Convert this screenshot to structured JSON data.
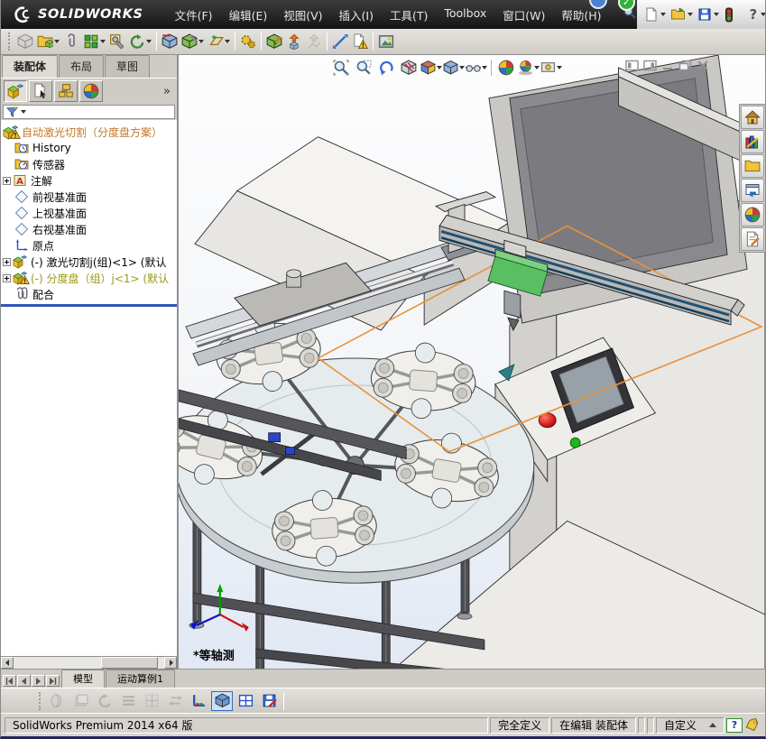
{
  "titlebar": {
    "logo_text": "SOLIDWORKS",
    "menus": [
      "文件(F)",
      "编辑(E)",
      "视图(V)",
      "插入(I)",
      "工具(T)",
      "Toolbox",
      "窗口(W)",
      "帮助(H)"
    ],
    "help_glyph": "?",
    "quick_icons": [
      "search",
      "new-document",
      "open-document",
      "save",
      "design-checker",
      "help"
    ],
    "window_buttons": [
      "minimize",
      "restore",
      "close"
    ]
  },
  "main_toolbar": {
    "icons": [
      "insert-component",
      "open-part",
      "mate",
      "linear-component-pattern",
      "smart-fasteners",
      "rotate-component",
      "move-component",
      "assembly-features",
      "reference-geometry",
      "assembly-xpert",
      "edit-component",
      "exploded-view",
      "explode-line-sketch",
      "measure",
      "interference-detection",
      "snapshot"
    ]
  },
  "command_tabs": {
    "items": [
      {
        "label": "装配体",
        "active": true
      },
      {
        "label": "布局",
        "active": false
      },
      {
        "label": "草图",
        "active": false
      }
    ]
  },
  "feature_panel": {
    "tab_icons": [
      "featuremanager-tree",
      "propertymanager",
      "configurationmanager",
      "displaymanager"
    ],
    "overflow_glyph": "»",
    "tree": [
      {
        "label": "自动激光切割（分度盘方案）",
        "icon": "assembly",
        "warning": true,
        "text_color": "#c0782a"
      },
      {
        "label": "History",
        "icon": "history-folder"
      },
      {
        "label": "传感器",
        "icon": "sensors-folder"
      },
      {
        "label": "注解",
        "icon": "annotations",
        "expandable": true
      },
      {
        "label": "前视基准面",
        "icon": "plane"
      },
      {
        "label": "上视基准面",
        "icon": "plane"
      },
      {
        "label": "右视基准面",
        "icon": "plane"
      },
      {
        "label": "原点",
        "icon": "origin"
      },
      {
        "label": "(-) 激光切割j(组)<1> (默认",
        "icon": "component",
        "expandable": true
      },
      {
        "label": "(-) 分度盘（组）j<1> (默认",
        "icon": "component",
        "warning": true,
        "expandable": true,
        "text_color": "#9a9a1a"
      },
      {
        "label": "配合",
        "icon": "mates"
      }
    ]
  },
  "viewport": {
    "headsup_icons": [
      "zoom-to-fit",
      "zoom-to-area",
      "previous-view",
      "section-view",
      "view-orientation",
      "display-style",
      "hide-show-items",
      "edit-appearance",
      "apply-scene",
      "view-settings"
    ],
    "mdi_buttons": [
      "split-left",
      "split-right",
      "minimize",
      "restore",
      "close"
    ],
    "view_label": "*等轴测",
    "selection_color": "#e8923a"
  },
  "task_pane": {
    "icons": [
      "solidworks-resources",
      "design-library",
      "file-explorer",
      "view-palette",
      "appearances-scenes",
      "custom-properties"
    ]
  },
  "bottom_bar": {
    "tabs": [
      {
        "label": "模型",
        "active": true
      },
      {
        "label": "运动算例1",
        "active": false
      }
    ],
    "toolbar_icons": [
      "assembly-visualization",
      "performance-evaluation",
      "curvature",
      "section-properties",
      "mass-properties",
      "reload",
      "reference-triad",
      "shaded-with-edges",
      "split-horizontal",
      "save-table"
    ]
  },
  "statusbar": {
    "app_version": "SolidWorks Premium 2014 x64 版",
    "define_status": "完全定义",
    "edit_status": "在编辑 装配体",
    "custom_label": "自定义",
    "help_glyph": "?"
  }
}
